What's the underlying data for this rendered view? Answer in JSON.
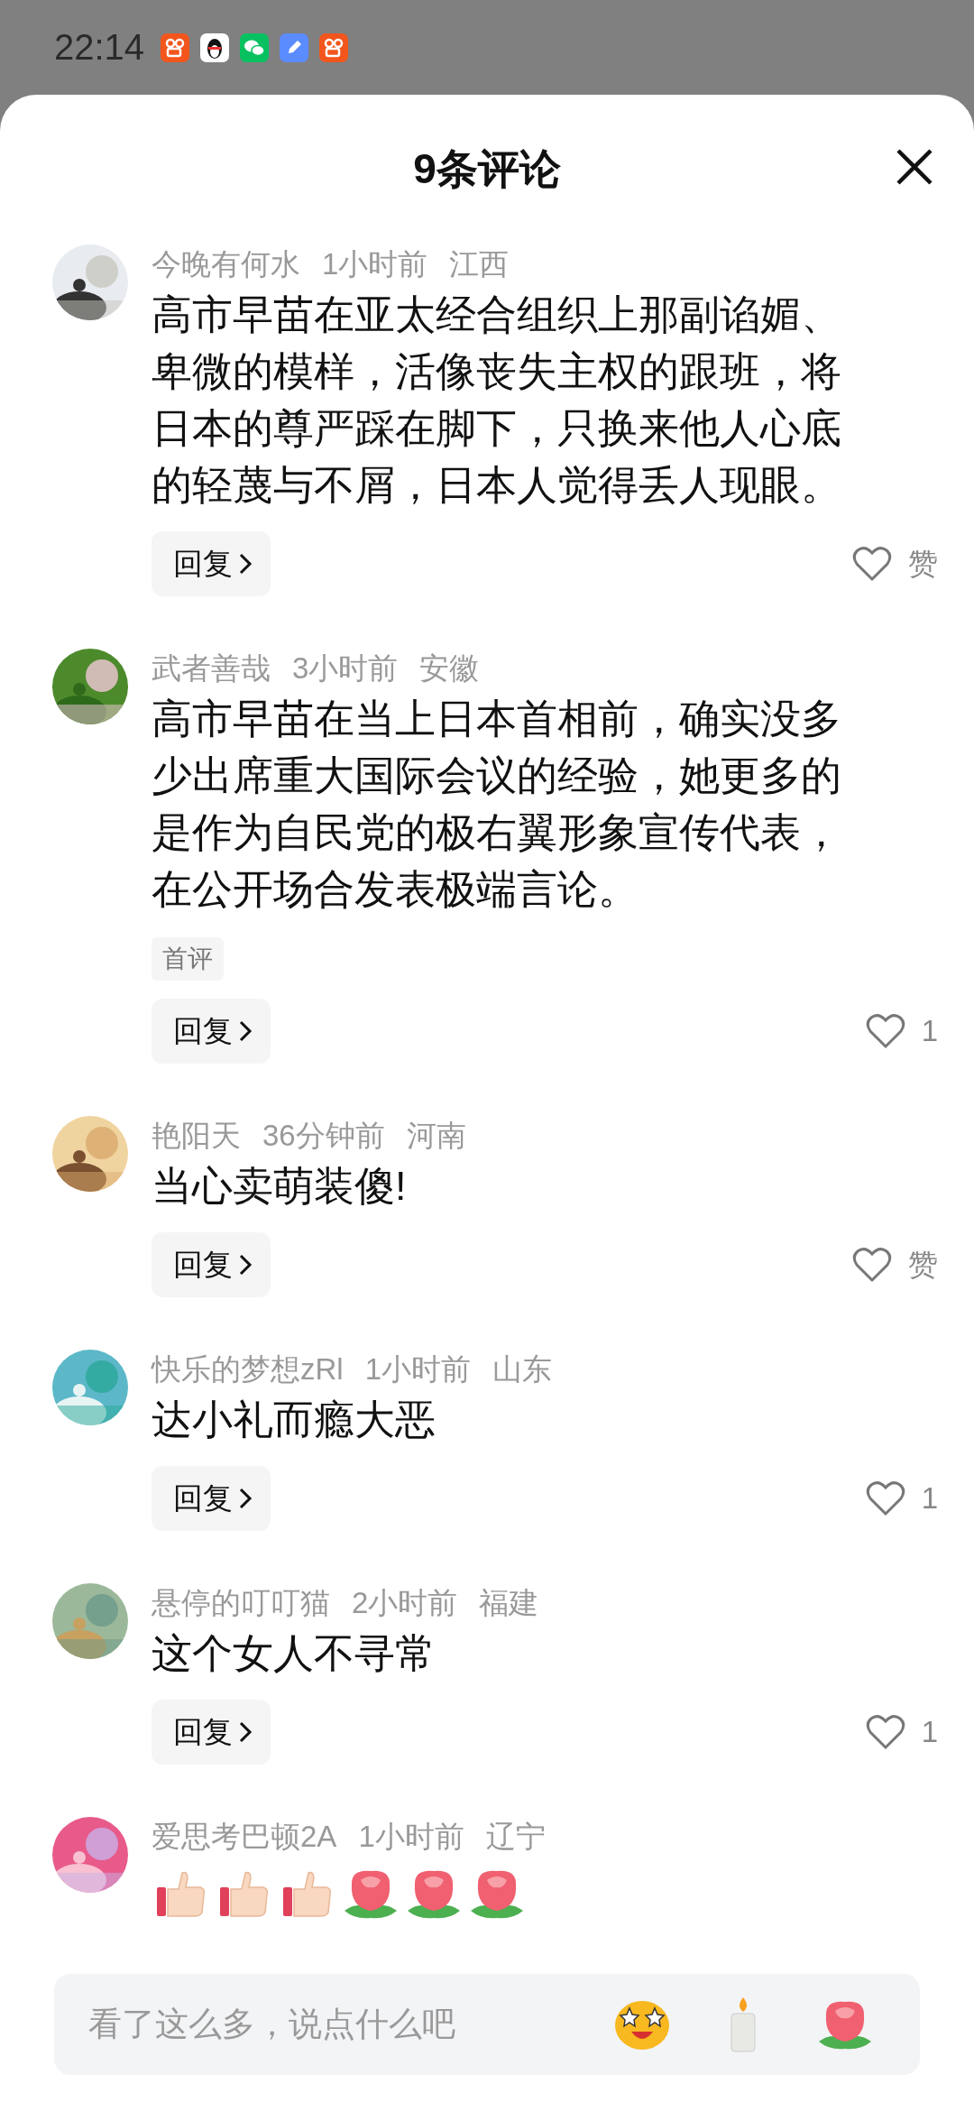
{
  "status_bar": {
    "time": "22:14",
    "apps": [
      {
        "kind": "video"
      },
      {
        "kind": "penguin"
      },
      {
        "kind": "chat"
      },
      {
        "kind": "pen"
      },
      {
        "kind": "video"
      }
    ]
  },
  "sheet": {
    "title": "9条评论"
  },
  "comments": [
    {
      "user": "今晚有何水",
      "time": "1小时前",
      "region": "江西",
      "text": "高市早苗在亚太经合组织上那副谄媚、卑微的模样，活像丧失主权的跟班，将日本的尊严踩在脚下，只换来他人心底的轻蔑与不屑，日本人觉得丢人现眼。",
      "reply": "回复",
      "likes": "赞"
    },
    {
      "user": "武者善哉",
      "time": "3小时前",
      "region": "安徽",
      "text": "高市早苗在当上日本首相前，确实没多少出席重大国际会议的经验，她更多的是作为自民党的极右翼形象宣传代表，在公开场合发表极端言论。",
      "tag": "首评",
      "reply": "回复",
      "likes": "1"
    },
    {
      "user": "艳阳天",
      "time": "36分钟前",
      "region": "河南",
      "text": "当心卖萌装傻!",
      "reply": "回复",
      "likes": "赞"
    },
    {
      "user": "快乐的梦想zRl",
      "time": "1小时前",
      "region": "山东",
      "text": "达小礼而瘾大恶",
      "reply": "回复",
      "likes": "1"
    },
    {
      "user": "悬停的叮叮猫",
      "time": "2小时前",
      "region": "福建",
      "text": "这个女人不寻常",
      "reply": "回复",
      "likes": "1"
    },
    {
      "user": "爱思考巴顿2A",
      "time": "1小时前",
      "region": "辽宁",
      "stickers": [
        {
          "kind": "thumbs-up"
        },
        {
          "kind": "thumbs-up"
        },
        {
          "kind": "thumbs-up"
        },
        {
          "kind": "rose"
        },
        {
          "kind": "rose"
        },
        {
          "kind": "rose"
        }
      ]
    }
  ],
  "input": {
    "placeholder": "看了这么多，说点什么吧"
  }
}
